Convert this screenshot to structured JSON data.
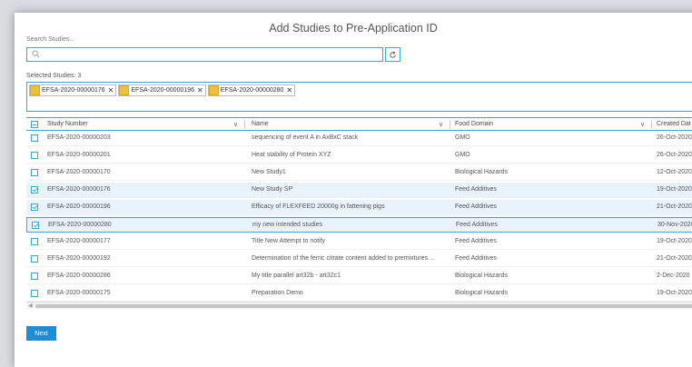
{
  "dialog": {
    "title": "Add Studies to Pre-Application ID",
    "search_label": "Search Studies...",
    "search_value": "",
    "selected_label": "Selected Studies: 3",
    "next_label": "Next"
  },
  "chips": [
    {
      "label": "EFSA-2020-00000176"
    },
    {
      "label": "EFSA-2020-00000196"
    },
    {
      "label": "EFSA-2020-00000280"
    }
  ],
  "table": {
    "columns": [
      "Study Number",
      "Name",
      "Food Domain",
      "Created Dat"
    ],
    "rows": [
      {
        "number": "EFSA-2020-00000203",
        "name": "sequencing of event A in AxBxC stack",
        "domain": "GMO",
        "created": "26-Oct-2020",
        "checked": false
      },
      {
        "number": "EFSA-2020-00000201",
        "name": "Heat stability of Protein XYZ",
        "domain": "GMO",
        "created": "26-Oct-2020",
        "checked": false
      },
      {
        "number": "EFSA-2020-00000170",
        "name": "New Study1",
        "domain": "Biological Hazards",
        "created": "12-Oct-2020",
        "checked": false
      },
      {
        "number": "EFSA-2020-00000176",
        "name": "New Study SP",
        "domain": "Feed Additives",
        "created": "19-Oct-2020",
        "checked": true
      },
      {
        "number": "EFSA-2020-00000196",
        "name": "Efficacy of FLEXFEED 20000g in fattening pigs",
        "domain": "Feed Additives",
        "created": "21-Oct-2020",
        "checked": true
      },
      {
        "number": "EFSA-2020-00000280",
        "name": "my new intended studies",
        "domain": "Feed Additives",
        "created": "30-Nov-2020",
        "checked": true
      },
      {
        "number": "EFSA-2020-00000177",
        "name": "Title New Attempt to notify",
        "domain": "Feed Additives",
        "created": "19-Oct-2020",
        "checked": false
      },
      {
        "number": "EFSA-2020-00000192",
        "name": "Determination of the ferric citrate content added to premixtures ...",
        "domain": "Feed Additives",
        "created": "21-Oct-2020",
        "checked": false
      },
      {
        "number": "EFSA-2020-00000286",
        "name": "My title parallel art32b - art32c1",
        "domain": "Biological Hazards",
        "created": "2-Dec-2020",
        "checked": false
      },
      {
        "number": "EFSA-2020-00000175",
        "name": "Preparation Demo",
        "domain": "Biological Hazards",
        "created": "19-Oct-2020",
        "checked": false
      }
    ]
  },
  "colors": {
    "accent": "#3aa3d8",
    "button": "#1f8dd6",
    "chip_icon": "#f0c03c"
  },
  "icons": {
    "search": "search-icon",
    "refresh": "refresh-icon",
    "sort": "chevron-down-icon"
  }
}
